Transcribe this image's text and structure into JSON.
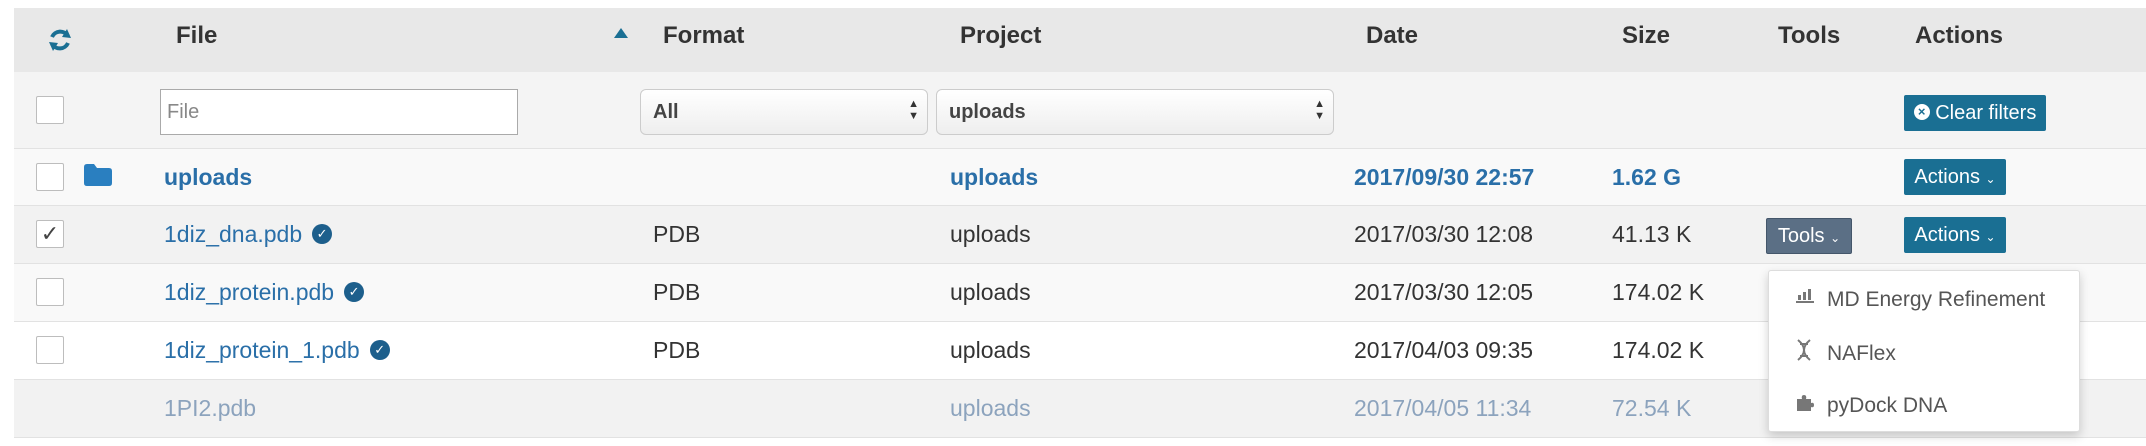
{
  "header": {
    "refresh_icon": "refresh-icon",
    "file": "File",
    "sort_icon": "sort-asc-icon",
    "format": "Format",
    "project": "Project",
    "date": "Date",
    "size": "Size",
    "tools": "Tools",
    "actions": "Actions"
  },
  "filters": {
    "file_placeholder": "File",
    "file_value": "",
    "format_selected": "All",
    "project_selected": "uploads",
    "clear_label": "Clear filters",
    "clear_icon": "times-circle-icon"
  },
  "rows": [
    {
      "type": "folder",
      "icon": "folder-icon",
      "file": "uploads",
      "format": "",
      "project": "uploads",
      "date": "2017/09/30 22:57",
      "size": "1.62 G",
      "checked": false,
      "actions": "Actions"
    },
    {
      "type": "file",
      "file": "1diz_dna.pdb",
      "verified": true,
      "format": "PDB",
      "project": "uploads",
      "date": "2017/03/30 12:08",
      "size": "41.13 K",
      "checked": true,
      "tools": "Tools",
      "actions": "Actions"
    },
    {
      "type": "file",
      "file": "1diz_protein.pdb",
      "verified": true,
      "format": "PDB",
      "project": "uploads",
      "date": "2017/03/30 12:05",
      "size": "174.02 K",
      "checked": false
    },
    {
      "type": "file",
      "file": "1diz_protein_1.pdb",
      "verified": true,
      "format": "PDB",
      "project": "uploads",
      "date": "2017/04/03 09:35",
      "size": "174.02 K",
      "checked": false
    },
    {
      "type": "file",
      "file": "1PI2.pdb",
      "verified": false,
      "format": "",
      "project": "uploads",
      "date": "2017/04/05 11:34",
      "size": "72.54 K",
      "checked": false,
      "disabled": true
    }
  ],
  "tools_menu": [
    {
      "label": "MD Energy Refinement",
      "icon": "bar-chart-icon"
    },
    {
      "label": "NAFlex",
      "icon": "dna-icon"
    },
    {
      "label": "pyDock DNA",
      "icon": "puzzle-icon"
    }
  ],
  "colors": {
    "accent": "#1a6f93",
    "link": "#2a6fa8",
    "header_bg": "#e8e8e8",
    "tools_button": "#5b6f85"
  }
}
